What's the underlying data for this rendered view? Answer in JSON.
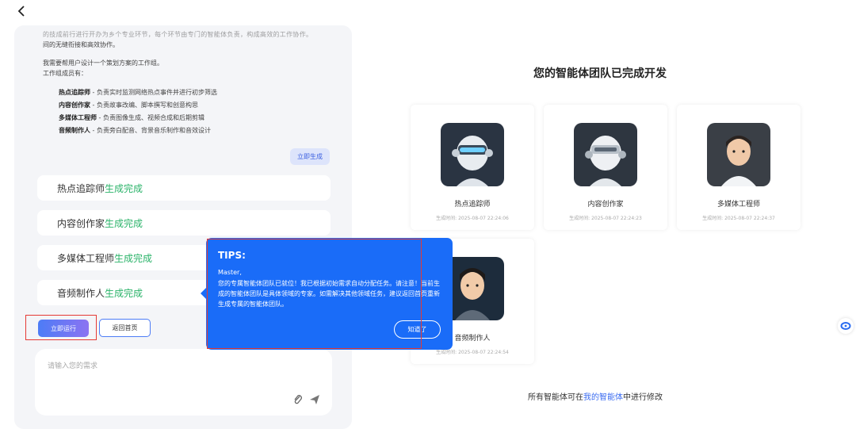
{
  "nav": {
    "back_label": "back"
  },
  "chat": {
    "cut_line1": "的技成前行进行开办为乡个专业环节，每个环节由专门的智能体负责，构成高效的工作协作。",
    "cut_line2": "间的无缝衔接和高效协作。",
    "intro": "我需要帮用户设计一个策划方案的工作组。",
    "members_label": "工作组成员有：",
    "members": [
      {
        "name": "热点追踪师",
        "desc": " - 负责实时监测网络热点事件并进行初步筛选"
      },
      {
        "name": "内容创作家",
        "desc": " - 负责故事改编、脚本撰写和创意构思"
      },
      {
        "name": "多媒体工程师",
        "desc": " - 负责图像生成、视频合成和后期剪辑"
      },
      {
        "name": "音频制作人",
        "desc": " - 负责旁白配音、背景音乐制作和音效设计"
      }
    ],
    "generate_label": "立即生成",
    "status": [
      {
        "name": "热点追踪师",
        "state": "生成完成"
      },
      {
        "name": "内容创作家",
        "state": "生成完成"
      },
      {
        "name": "多媒体工程师",
        "state": "生成完成"
      },
      {
        "name": "音频制作人",
        "state": "生成完成"
      }
    ],
    "run_label": "立即运行",
    "home_label": "返回首页",
    "input_placeholder": "请输入您的需求"
  },
  "team": {
    "title": "您的智能体团队已完成开发",
    "agents": [
      {
        "name": "热点追踪师",
        "time": "生成时间: 2025-08-07 22:24:06"
      },
      {
        "name": "内容创作家",
        "time": "生成时间: 2025-08-07 22:24:23"
      },
      {
        "name": "多媒体工程师",
        "time": "生成时间: 2025-08-07 22:24:37"
      },
      {
        "name": "音频制作人",
        "time": "生成时间: 2025-08-07 22:24:54"
      }
    ],
    "footer_prefix": "所有智能体可在",
    "footer_link": "我的智能体",
    "footer_suffix": "中进行修改"
  },
  "tips": {
    "title": "TIPS:",
    "greeting": "Master,",
    "body": "您的专属智能体团队已就位！我已根据初始需求自动分配任务。请注意！当前生成的智能体团队是具体领域的专家。如需解决其他领域任务，建议返回首页重新生成专属的智能体团队。",
    "ok_label": "知道了"
  },
  "colors": {
    "accent": "#1a6cf8",
    "success": "#2bb36a",
    "link": "#3b6cf0",
    "highlight": "#e53935"
  }
}
